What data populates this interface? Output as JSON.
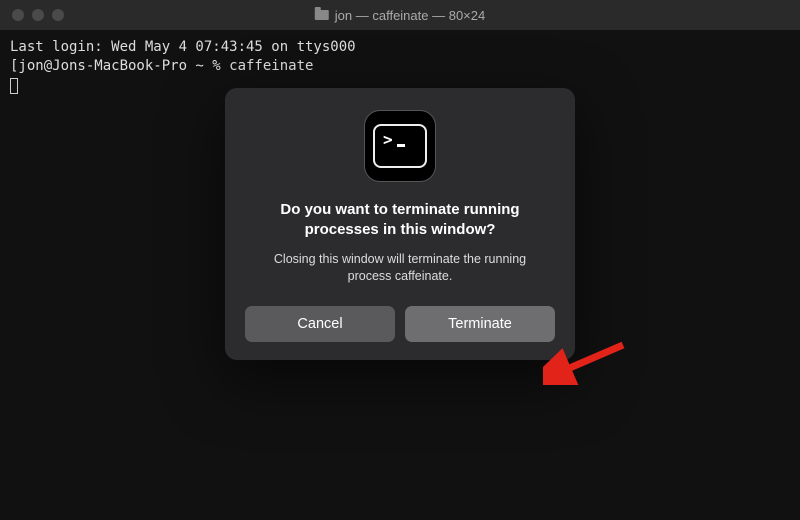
{
  "window": {
    "title": "jon — caffeinate — 80×24"
  },
  "terminal": {
    "line1": "Last login: Wed May  4 07:43:45 on ttys000",
    "line2": "[jon@Jons-MacBook-Pro ~ % caffeinate"
  },
  "dialog": {
    "title": "Do you want to terminate running processes in this window?",
    "message": "Closing this window will terminate the running process caffeinate.",
    "cancel_label": "Cancel",
    "terminate_label": "Terminate"
  }
}
